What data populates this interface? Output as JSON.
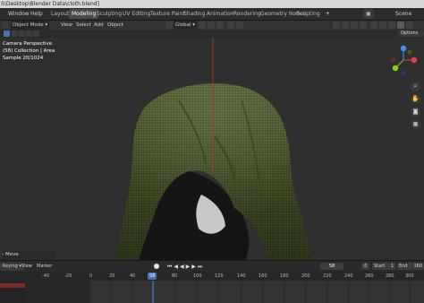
{
  "window": {
    "title": "S\\Desktop\\Blender Data\\cloth.blend]"
  },
  "menubar": {
    "items": [
      "Window",
      "Help"
    ],
    "workspaces": [
      "Layout",
      "Modeling",
      "Sculpting",
      "UV Editing",
      "Texture Paint",
      "Shading",
      "Animation",
      "Rendering",
      "Geometry Nodes",
      "Scripting"
    ],
    "active_workspace": "Modeling",
    "scene_label": "Scene"
  },
  "header": {
    "mode": "Object Mode",
    "menus": [
      "View",
      "Select",
      "Add",
      "Object"
    ],
    "transform_orientation": "Global",
    "options_label": "Options"
  },
  "viewport": {
    "overlay_lines": [
      "Camera Perspective",
      "(58) Collection | Area",
      "Sample 20/1024"
    ],
    "status_label": "Move",
    "cloth_color": "#4b5a2a",
    "background_color": "#2f2f2f",
    "axis_color": "#c0392b"
  },
  "timeline": {
    "menus": [
      "Keying",
      "View",
      "Marker"
    ],
    "current_frame": "58",
    "start_label": "Start",
    "start_value": "1",
    "end_label": "End",
    "end_value": "160",
    "ticks": [
      "-40",
      "-20",
      "0",
      "20",
      "40",
      "58",
      "80",
      "100",
      "120",
      "140",
      "160",
      "180",
      "200",
      "220",
      "240",
      "260",
      "280",
      "300",
      "320"
    ],
    "playhead_color": "#4772b3"
  }
}
